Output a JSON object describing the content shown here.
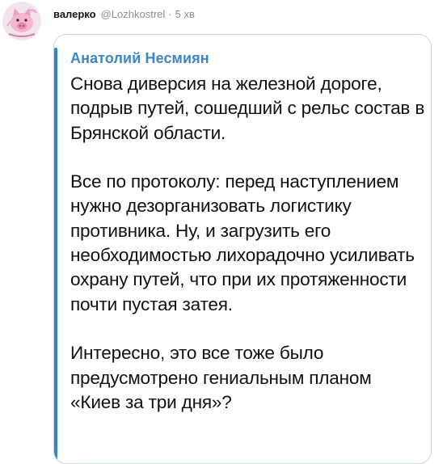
{
  "tweet": {
    "author_name": "валерко",
    "handle": "@Lozhkostrel",
    "separator": "·",
    "time": "5 хв",
    "avatar_icon": "pig-avatar-icon"
  },
  "screenshot": {
    "source_author": "Анатолий Несмиян",
    "accent_color": "#3a86c7",
    "paragraphs": [
      "Снова диверсия на железной дороге, подрыв путей, сошедший с рельс состав в Брянской области.",
      "Все по протоколу: перед наступлением нужно дезорганизовать логистику противника. Ну, и загрузить его необходимостью лихорадочно усиливать охрану путей, что при их протяженности почти пустая затея.",
      "Интересно, это все тоже было предусмотрено гениальным планом «Киев за три дня»?"
    ]
  }
}
